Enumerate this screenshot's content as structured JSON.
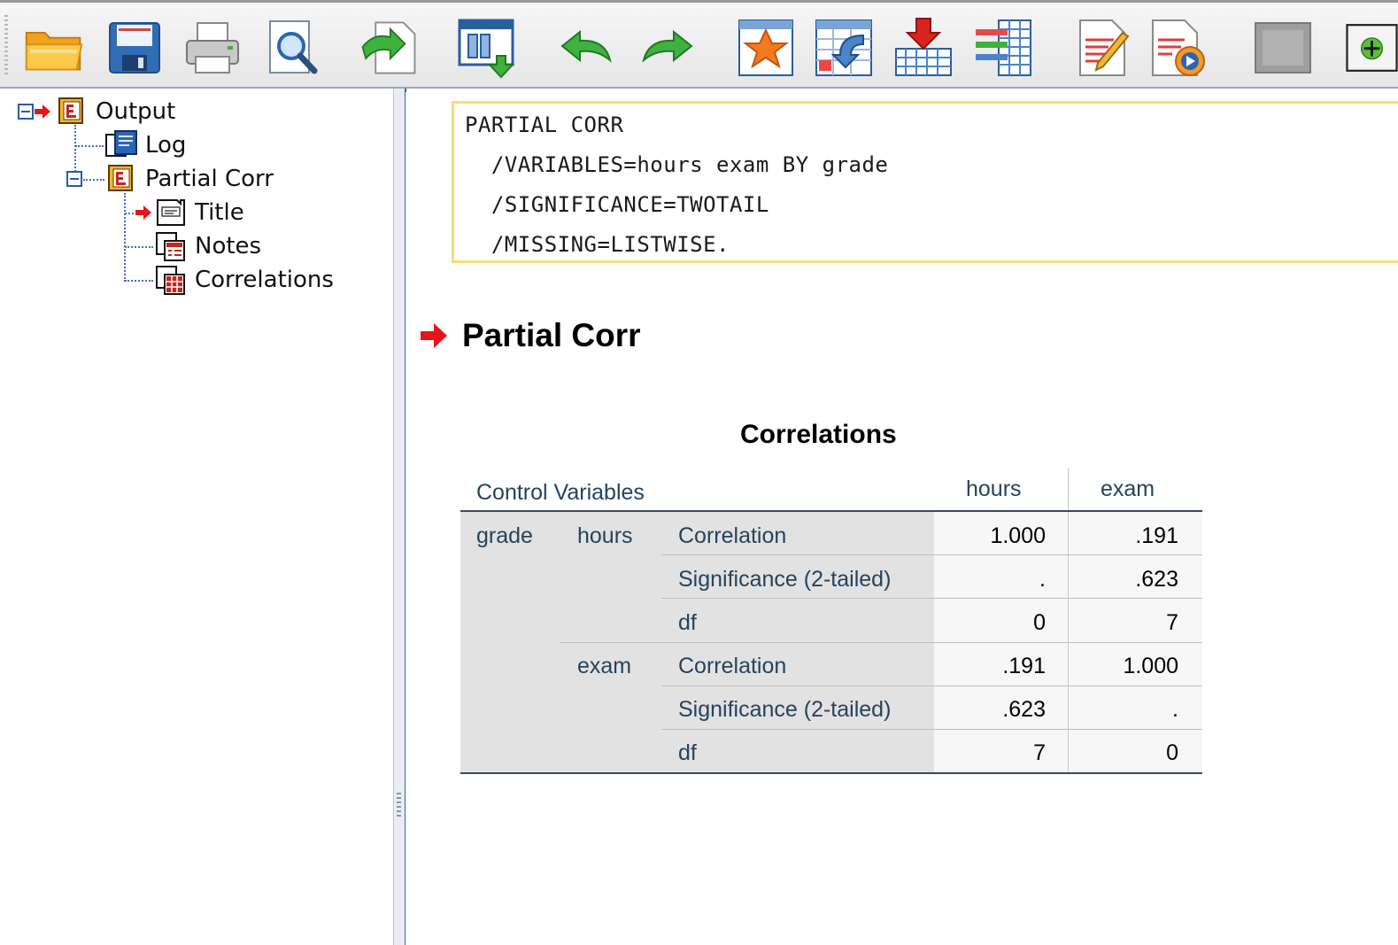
{
  "toolbar": {
    "buttons": [
      {
        "name": "open-icon"
      },
      {
        "name": "save-icon"
      },
      {
        "name": "print-icon"
      },
      {
        "name": "print-preview-icon"
      },
      {
        "name": "export-icon"
      },
      {
        "name": "recall-dialog-icon"
      },
      {
        "name": "undo-icon"
      },
      {
        "name": "redo-icon"
      },
      {
        "name": "goto-data-icon"
      },
      {
        "name": "goto-case-icon"
      },
      {
        "name": "insert-case-icon"
      },
      {
        "name": "variables-icon"
      },
      {
        "name": "edit-output-icon"
      },
      {
        "name": "run-script-icon"
      },
      {
        "name": "disabled-icon"
      },
      {
        "name": "add-icon"
      }
    ]
  },
  "tree": {
    "output": "Output",
    "log": "Log",
    "partial_corr": "Partial Corr",
    "title": "Title",
    "notes": "Notes",
    "correlations": "Correlations"
  },
  "syntax": {
    "lines": [
      "PARTIAL CORR",
      "  /VARIABLES=hours exam BY grade",
      "  /SIGNIFICANCE=TWOTAIL",
      "  /MISSING=LISTWISE."
    ]
  },
  "section": {
    "title": "Partial Corr"
  },
  "table": {
    "title": "Correlations",
    "header": {
      "control": "Control Variables",
      "col1": "hours",
      "col2": "exam"
    },
    "control_var": "grade",
    "rows": [
      {
        "var": "hours",
        "stat": "Correlation",
        "v1": "1.000",
        "v2": ".191"
      },
      {
        "var": "",
        "stat": "Significance (2-tailed)",
        "v1": ".",
        "v2": ".623"
      },
      {
        "var": "",
        "stat": "df",
        "v1": "0",
        "v2": "7"
      },
      {
        "var": "exam",
        "stat": "Correlation",
        "v1": ".191",
        "v2": "1.000"
      },
      {
        "var": "",
        "stat": "Significance (2-tailed)",
        "v1": ".623",
        "v2": "."
      },
      {
        "var": "",
        "stat": "df",
        "v1": "7",
        "v2": "0"
      }
    ]
  },
  "colors": {
    "accent_red": "#e8141b",
    "label_blue": "#26435c",
    "syntax_border": "#f7dc7f",
    "tree_line": "#3a6fd0"
  }
}
